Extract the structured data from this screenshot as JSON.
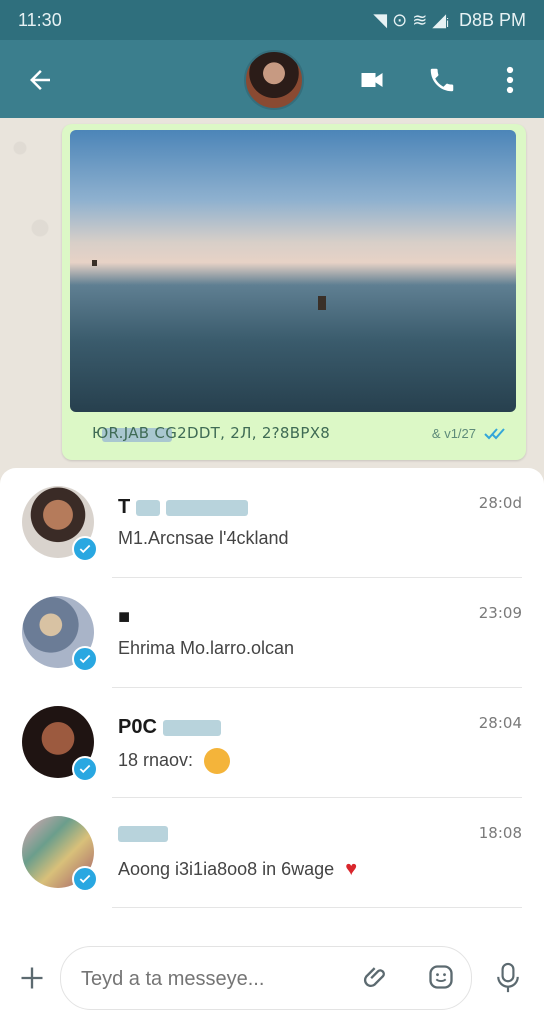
{
  "status_bar": {
    "time": "11:30",
    "right_text": "D8B PM",
    "icons_text": "◥ ⊙ ≋ ◢ᵢ"
  },
  "header": {
    "back_icon": "arrow-left-icon",
    "video_icon": "video-icon",
    "call_icon": "phone-icon",
    "more_icon": "more-vert-icon"
  },
  "message": {
    "caption": "ЮR.JAB CG2DDT, 2Л, 2?8BPX8",
    "time": "& v1/27",
    "read_icon": "double-check-icon"
  },
  "chats": [
    {
      "name_prefix": "T",
      "preview": "M1.Arcnsae l'4cklаnd",
      "time": "28:0d"
    },
    {
      "name_prefix": "■",
      "preview": "Ehrima Mo.larro.olcan",
      "time": "23:09"
    },
    {
      "name_prefix": "P0C",
      "preview": "18 rnaov:",
      "time": "28:04"
    },
    {
      "name_prefix": "",
      "preview": "Aoong i3i1ia8oo8 in 6wage",
      "time": "18:08"
    }
  ],
  "composer": {
    "placeholder": "Teyd a ta messeye..."
  },
  "colors": {
    "header": "#3b7e8d",
    "status": "#2f6f7d",
    "bubble": "#dcf8c6",
    "badge": "#29a7e1"
  }
}
